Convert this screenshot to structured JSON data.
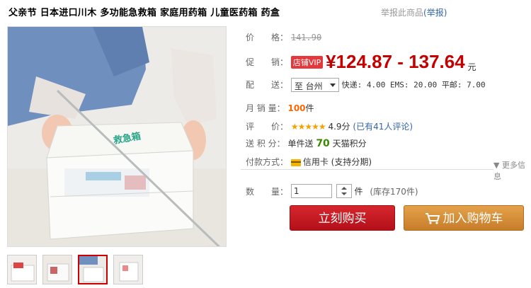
{
  "title": "父亲节 日本进口川木 多功能急救箱 家庭用药箱 儿童医药箱 药盒",
  "report": {
    "text": "举报此商品",
    "link": "(举报)"
  },
  "price": {
    "label": "价　　格：",
    "original": "141.90"
  },
  "promo": {
    "label": "促　　销：",
    "badge": "店铺VIP",
    "range": "¥124.87 - 137.64",
    "unit": "元"
  },
  "shipping": {
    "label": "配　　送：",
    "destination": "至 台州",
    "detail": "快递: 4.00 EMS: 20.00 平邮: 7.00"
  },
  "sales": {
    "label": "月 销 量：",
    "count": "100",
    "unit": "件"
  },
  "rating": {
    "label": "评　　价：",
    "stars": "★★★★★",
    "score": "4.9分",
    "reviews": "(已有41人评论)"
  },
  "points": {
    "label": "送 积 分：",
    "prefix": "单件送",
    "value": "70",
    "suffix": "天猫积分"
  },
  "payment": {
    "label": "付款方式：",
    "method": "信用卡 (支持分期)"
  },
  "more_info": "▼ 更多信息",
  "quantity": {
    "label": "数　　量：",
    "value": "1",
    "unit": "件",
    "stock": "(库存170件)"
  },
  "buttons": {
    "buy": "立刻购买",
    "cart": "加入购物车"
  },
  "colors": {
    "price_red": "#c40000",
    "buy_red": "#c41a22",
    "cart_orange": "#d68c37"
  }
}
